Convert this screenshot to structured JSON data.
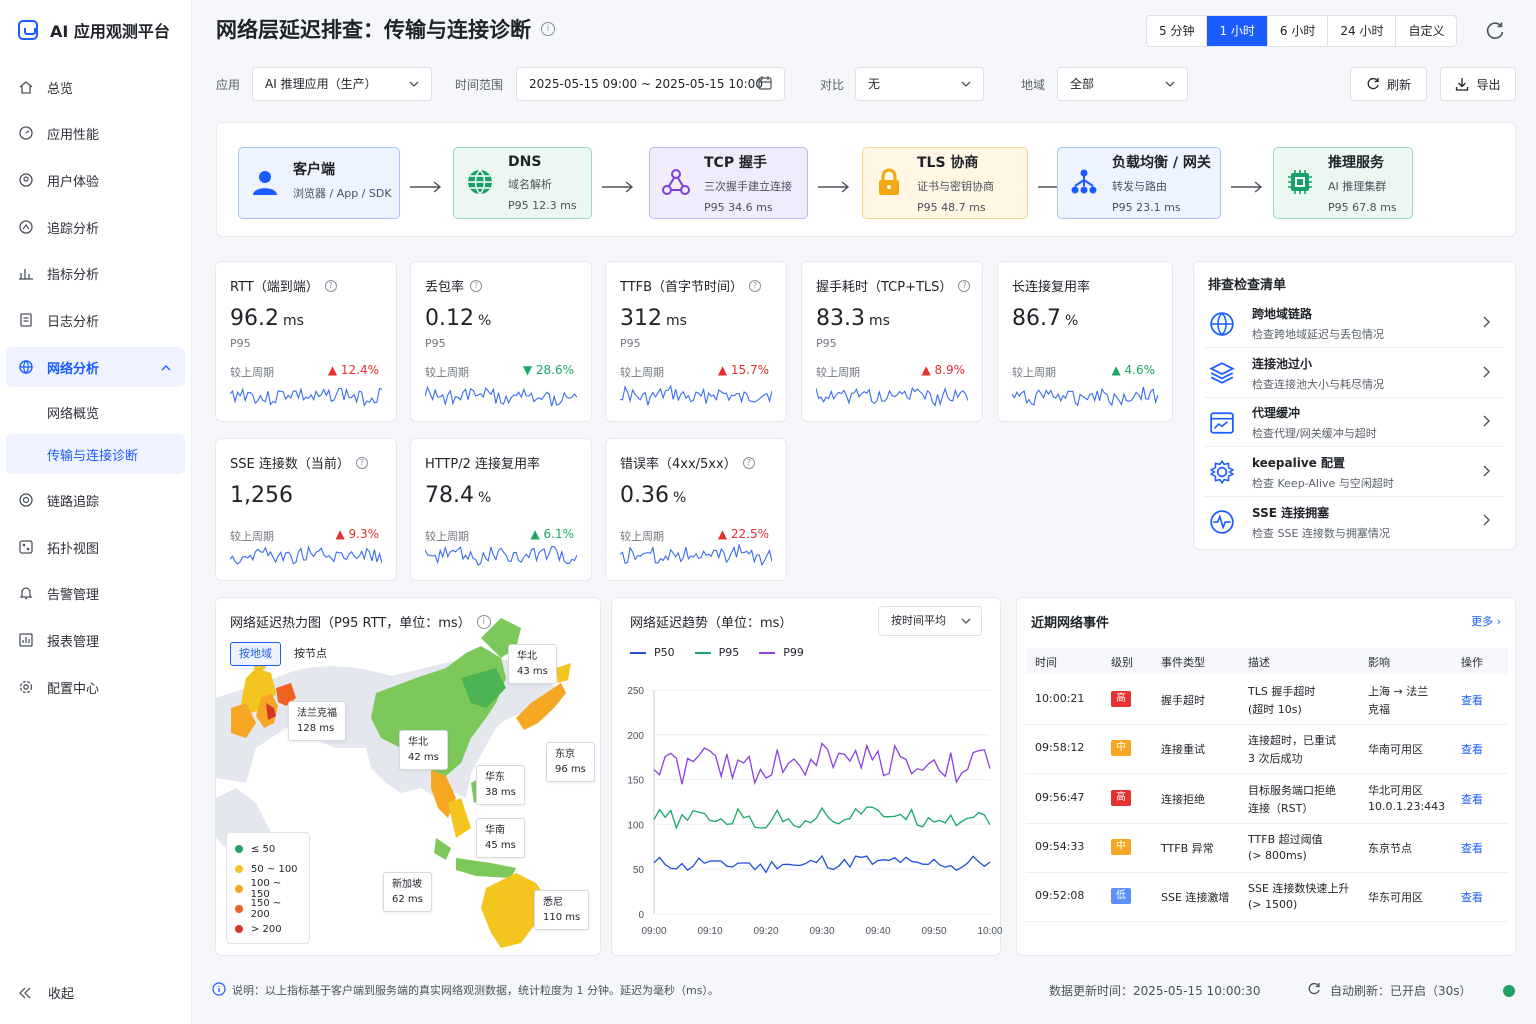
{
  "app": {
    "name": "AI 应用观测平台"
  },
  "nav": {
    "items": [
      {
        "label": "总览"
      },
      {
        "label": "应用性能"
      },
      {
        "label": "用户体验"
      },
      {
        "label": "追踪分析"
      },
      {
        "label": "指标分析"
      },
      {
        "label": "日志分析"
      },
      {
        "label": "网络分析"
      },
      {
        "label": "网络概览"
      },
      {
        "label": "传输与连接诊断"
      },
      {
        "label": "链路追踪"
      },
      {
        "label": "拓扑视图"
      },
      {
        "label": "告警管理"
      },
      {
        "label": "报表管理"
      },
      {
        "label": "配置中心"
      }
    ],
    "collapse": "收起"
  },
  "page": {
    "title": "网络层延迟排查：传输与连接诊断"
  },
  "time_ranges": [
    "5 分钟",
    "1 小时",
    "6 小时",
    "24 小时",
    "自定义"
  ],
  "time_range_selected": "1 小时",
  "filters": {
    "app_label": "应用",
    "app_value": "AI 推理应用（生产）",
    "range_label": "时间范围",
    "range_value": "2025-05-15 09:00 ~ 2025-05-15 10:00",
    "compare_label": "对比",
    "compare_value": "无",
    "region_label": "地域",
    "region_value": "全部",
    "refresh": "刷新",
    "export": "导出"
  },
  "flow": [
    {
      "title": "客户端",
      "sub": "浏览器 / App / SDK",
      "p95": ""
    },
    {
      "title": "DNS",
      "sub": "域名解析",
      "p95": "P95 12.3 ms"
    },
    {
      "title": "TCP 握手",
      "sub": "三次握手建立连接",
      "p95": "P95 34.6 ms"
    },
    {
      "title": "TLS 协商",
      "sub": "证书与密钥协商",
      "p95": "P95 48.7 ms"
    },
    {
      "title": "负载均衡 / 网关",
      "sub": "转发与路由",
      "p95": "P95 23.1 ms"
    },
    {
      "title": "推理服务",
      "sub": "AI 推理集群",
      "p95": "P95 67.8 ms"
    }
  ],
  "metrics": [
    {
      "title": "RTT（端到端）",
      "value": "96.2",
      "unit": "ms",
      "p95": "P95",
      "cmp": "较上周期",
      "change": "12.4%",
      "dir": "up",
      "info": true
    },
    {
      "title": "丢包率",
      "value": "0.12",
      "unit": "%",
      "p95": "P95",
      "cmp": "较上周期",
      "change": "28.6%",
      "dir": "down",
      "info": true
    },
    {
      "title": "TTFB（首字节时间）",
      "value": "312",
      "unit": "ms",
      "p95": "P95",
      "cmp": "较上周期",
      "change": "15.7%",
      "dir": "up",
      "info": true
    },
    {
      "title": "握手耗时（TCP+TLS）",
      "value": "83.3",
      "unit": "ms",
      "p95": "P95",
      "cmp": "较上周期",
      "change": "8.9%",
      "dir": "up",
      "info": true
    },
    {
      "title": "长连接复用率",
      "value": "86.7",
      "unit": "%",
      "p95": "",
      "cmp": "较上周期",
      "change": "4.6%",
      "dir": "upgood",
      "info": false
    },
    {
      "title": "SSE 连接数（当前）",
      "value": "1,256",
      "unit": "",
      "p95": "",
      "cmp": "较上周期",
      "change": "9.3%",
      "dir": "up",
      "info": true
    },
    {
      "title": "HTTP/2 连接复用率",
      "value": "78.4",
      "unit": "%",
      "p95": "",
      "cmp": "较上周期",
      "change": "6.1%",
      "dir": "upgood",
      "info": false
    },
    {
      "title": "错误率（4xx/5xx）",
      "value": "0.36",
      "unit": "%",
      "p95": "",
      "cmp": "较上周期",
      "change": "22.5%",
      "dir": "up",
      "info": true
    }
  ],
  "checklist": {
    "title": "排查检查清单",
    "items": [
      {
        "title": "跨地域链路",
        "sub": "检查跨地域延迟与丢包情况",
        "icon": "globe-icon"
      },
      {
        "title": "连接池过小",
        "sub": "检查连接池大小与耗尽情况",
        "icon": "layers-icon"
      },
      {
        "title": "代理缓冲",
        "sub": "检查代理/网关缓冲与超时",
        "icon": "chart-window-icon"
      },
      {
        "title": "keepalive 配置",
        "sub": "检查 Keep-Alive 与空闲超时",
        "icon": "gear-icon"
      },
      {
        "title": "SSE 连接拥塞",
        "sub": "检查 SSE 连接数与拥塞情况",
        "icon": "pulse-icon"
      }
    ]
  },
  "heatmap": {
    "title": "网络延迟热力图（P95 RTT，单位：ms）",
    "tabs": [
      "按地域",
      "按节点"
    ],
    "labels": [
      {
        "name": "华北",
        "value": "43 ms"
      },
      {
        "name": "法兰克福",
        "value": "128 ms"
      },
      {
        "name": "华北",
        "value": "42 ms"
      },
      {
        "name": "东京",
        "value": "96 ms"
      },
      {
        "name": "华东",
        "value": "38 ms"
      },
      {
        "name": "华南",
        "value": "45 ms"
      },
      {
        "name": "新加坡",
        "value": "62 ms"
      },
      {
        "name": "悉尼",
        "value": "110 ms"
      }
    ],
    "legend": [
      {
        "label": "≤ 50",
        "color": "#21a366"
      },
      {
        "label": "50 ~ 100",
        "color": "#f5c51f"
      },
      {
        "label": "100 ~ 150",
        "color": "#f5a623"
      },
      {
        "label": "150 ~ 200",
        "color": "#f0621f"
      },
      {
        "label": "> 200",
        "color": "#d9362b"
      }
    ]
  },
  "trend": {
    "title": "网络延迟趋势（单位：ms）",
    "agg": "按时间平均"
  },
  "chart_data": {
    "type": "line",
    "x": [
      "09:00",
      "09:10",
      "09:20",
      "09:30",
      "09:40",
      "09:50",
      "10:00"
    ],
    "ylim": [
      0,
      250
    ],
    "yticks": [
      0,
      50,
      100,
      150,
      200,
      250
    ],
    "grid": true,
    "legend": "top-left",
    "series": [
      {
        "name": "P50",
        "color": "#1f4fd8",
        "values": [
          55,
          56,
          54,
          57,
          59,
          55,
          57
        ]
      },
      {
        "name": "P95",
        "color": "#1aa864",
        "values": [
          105,
          108,
          104,
          109,
          113,
          107,
          109
        ]
      },
      {
        "name": "P99",
        "color": "#8a3fe0",
        "values": [
          165,
          168,
          164,
          172,
          175,
          167,
          167
        ]
      }
    ]
  },
  "events": {
    "title": "近期网络事件",
    "more": "更多",
    "headers": [
      "时间",
      "级别",
      "事件类型",
      "描述",
      "影响",
      "操作"
    ],
    "rows": [
      {
        "time": "10:00:21",
        "level": "高",
        "color": "#e5312f",
        "type": "握手超时",
        "desc1": "TLS 握手超时",
        "desc2": "(超时 10s)",
        "impact1": "上海 → 法兰",
        "impact2": "克福",
        "action": "查看"
      },
      {
        "time": "09:58:12",
        "level": "中",
        "color": "#f5a623",
        "type": "连接重试",
        "desc1": "连接超时，已重试",
        "desc2": "3 次后成功",
        "impact1": "华南可用区",
        "impact2": "",
        "action": "查看"
      },
      {
        "time": "09:56:47",
        "level": "高",
        "color": "#e5312f",
        "type": "连接拒绝",
        "desc1": "目标服务端口拒绝",
        "desc2": "连接（RST）",
        "impact1": "华北可用区",
        "impact2": "10.0.1.23:443",
        "action": "查看"
      },
      {
        "time": "09:54:33",
        "level": "中",
        "color": "#f5a623",
        "type": "TTFB 异常",
        "desc1": "TTFB 超过阈值",
        "desc2": "(> 800ms)",
        "impact1": "东京节点",
        "impact2": "",
        "action": "查看"
      },
      {
        "time": "09:52:08",
        "level": "低",
        "color": "#5b8ff9",
        "type": "SSE 连接激增",
        "desc1": "SSE 连接数快速上升",
        "desc2": "(> 1500)",
        "impact1": "华东可用区",
        "impact2": "",
        "action": "查看"
      }
    ]
  },
  "footer": {
    "note": "说明：以上指标基于客户端到服务端的真实网络观测数据，统计粒度为 1 分钟。延迟为毫秒（ms）。",
    "updated": "数据更新时间：2025-05-15 10:00:30",
    "auto": "自动刷新：已开启（30s）"
  }
}
